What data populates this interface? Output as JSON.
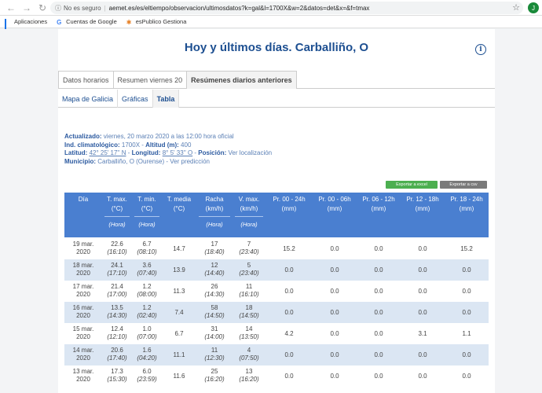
{
  "browser": {
    "security_label": "No es seguro",
    "url": "aemet.es/es/eltiempo/observacion/ultimosdatos?k=gal&l=1700X&w=2&datos=det&x=&f=tmax",
    "avatar_letter": "J",
    "bookmarks": [
      {
        "label": "Aplicaciones"
      },
      {
        "label": "Cuentas de Google"
      },
      {
        "label": "esPublico Gestiona"
      }
    ]
  },
  "page": {
    "title": "Hoy y últimos días. Carballiño, O"
  },
  "tabs_primary": [
    {
      "label": "Datos horarios"
    },
    {
      "label": "Resumen viernes 20"
    },
    {
      "label": "Resúmenes diarios anteriores"
    }
  ],
  "tabs_secondary": [
    {
      "label": "Mapa de Galicia"
    },
    {
      "label": "Gráficas"
    },
    {
      "label": "Tabla"
    }
  ],
  "station_info": {
    "updated_label": "Actualizado:",
    "updated_value": "viernes, 20 marzo 2020 a las 12:00 hora oficial",
    "index_label": "Ind. climatológico:",
    "index_value": "1700X",
    "altitude_label": "Altitud (m):",
    "altitude_value": "400",
    "latitude_label": "Latitud:",
    "latitude_value": "42° 25' 17'' N",
    "longitude_label": "Longitud:",
    "longitude_value": "8° 5' 33'' O",
    "position_label": "Posición:",
    "position_link": "Ver localización",
    "municipality_label": "Municipio:",
    "municipality_value": "Carballiño, O (Ourense)",
    "forecast_link": "Ver predicción"
  },
  "export": {
    "excel_label": "Exportar a excel",
    "csv_label": "Exportar a csv"
  },
  "table": {
    "headers": [
      {
        "l1": "Día",
        "l2": "",
        "l3": ""
      },
      {
        "l1": "T. max.",
        "l2": "(°C)",
        "l3": "(Hora)"
      },
      {
        "l1": "T. min.",
        "l2": "(°C)",
        "l3": "(Hora)"
      },
      {
        "l1": "T. media",
        "l2": "(°C)",
        "l3": ""
      },
      {
        "l1": "Racha",
        "l2": "(km/h)",
        "l3": "(Hora)"
      },
      {
        "l1": "V. max.",
        "l2": "(km/h)",
        "l3": "(Hora)"
      },
      {
        "l1": "Pr. 00 - 24h",
        "l2": "(mm)",
        "l3": ""
      },
      {
        "l1": "Pr. 00 - 06h",
        "l2": "(mm)",
        "l3": ""
      },
      {
        "l1": "Pr. 06 - 12h",
        "l2": "(mm)",
        "l3": ""
      },
      {
        "l1": "Pr. 12 - 18h",
        "l2": "(mm)",
        "l3": ""
      },
      {
        "l1": "Pr. 18 - 24h",
        "l2": "(mm)",
        "l3": ""
      }
    ],
    "rows": [
      {
        "day": "19 mar.",
        "year": "2020",
        "tmax": "22.6",
        "tmax_h": "(16:10)",
        "tmin": "6.7",
        "tmin_h": "(08:10)",
        "tmed": "14.7",
        "racha": "17",
        "racha_h": "(18:40)",
        "vmax": "7",
        "vmax_h": "(23:40)",
        "p24": "15.2",
        "p06": "0.0",
        "p12": "0.0",
        "p18": "0.0",
        "p24b": "15.2"
      },
      {
        "day": "18 mar.",
        "year": "2020",
        "tmax": "24.1",
        "tmax_h": "(17:10)",
        "tmin": "3.6",
        "tmin_h": "(07:40)",
        "tmed": "13.9",
        "racha": "12",
        "racha_h": "(14:40)",
        "vmax": "5",
        "vmax_h": "(23:40)",
        "p24": "0.0",
        "p06": "0.0",
        "p12": "0.0",
        "p18": "0.0",
        "p24b": "0.0"
      },
      {
        "day": "17 mar.",
        "year": "2020",
        "tmax": "21.4",
        "tmax_h": "(17:00)",
        "tmin": "1.2",
        "tmin_h": "(08:00)",
        "tmed": "11.3",
        "racha": "26",
        "racha_h": "(14:30)",
        "vmax": "11",
        "vmax_h": "(16:10)",
        "p24": "0.0",
        "p06": "0.0",
        "p12": "0.0",
        "p18": "0.0",
        "p24b": "0.0"
      },
      {
        "day": "16 mar.",
        "year": "2020",
        "tmax": "13.5",
        "tmax_h": "(14:30)",
        "tmin": "1.2",
        "tmin_h": "(02:40)",
        "tmed": "7.4",
        "racha": "58",
        "racha_h": "(14:50)",
        "vmax": "18",
        "vmax_h": "(14:50)",
        "p24": "0.0",
        "p06": "0.0",
        "p12": "0.0",
        "p18": "0.0",
        "p24b": "0.0"
      },
      {
        "day": "15 mar.",
        "year": "2020",
        "tmax": "12.4",
        "tmax_h": "(12:10)",
        "tmin": "1.0",
        "tmin_h": "(07:00)",
        "tmed": "6.7",
        "racha": "31",
        "racha_h": "(14:00)",
        "vmax": "14",
        "vmax_h": "(13:50)",
        "p24": "4.2",
        "p06": "0.0",
        "p12": "0.0",
        "p18": "3.1",
        "p24b": "1.1"
      },
      {
        "day": "14 mar.",
        "year": "2020",
        "tmax": "20.6",
        "tmax_h": "(17:40)",
        "tmin": "1.6",
        "tmin_h": "(04:20)",
        "tmed": "11.1",
        "racha": "11",
        "racha_h": "(12:30)",
        "vmax": "4",
        "vmax_h": "(07:50)",
        "p24": "0.0",
        "p06": "0.0",
        "p12": "0.0",
        "p18": "0.0",
        "p24b": "0.0"
      },
      {
        "day": "13 mar.",
        "year": "2020",
        "tmax": "17.3",
        "tmax_h": "(15:30)",
        "tmin": "6.0",
        "tmin_h": "(23:59)",
        "tmed": "11.6",
        "racha": "25",
        "racha_h": "(16:20)",
        "vmax": "13",
        "vmax_h": "(16:20)",
        "p24": "0.0",
        "p06": "0.0",
        "p12": "0.0",
        "p18": "0.0",
        "p24b": "0.0"
      }
    ]
  },
  "colors": {
    "title_blue": "#1d4f91",
    "header_blue": "#4a7fd0",
    "row_alt": "#dbe6f3",
    "excel_green": "#4caf50",
    "csv_gray": "#7a7a7a"
  }
}
